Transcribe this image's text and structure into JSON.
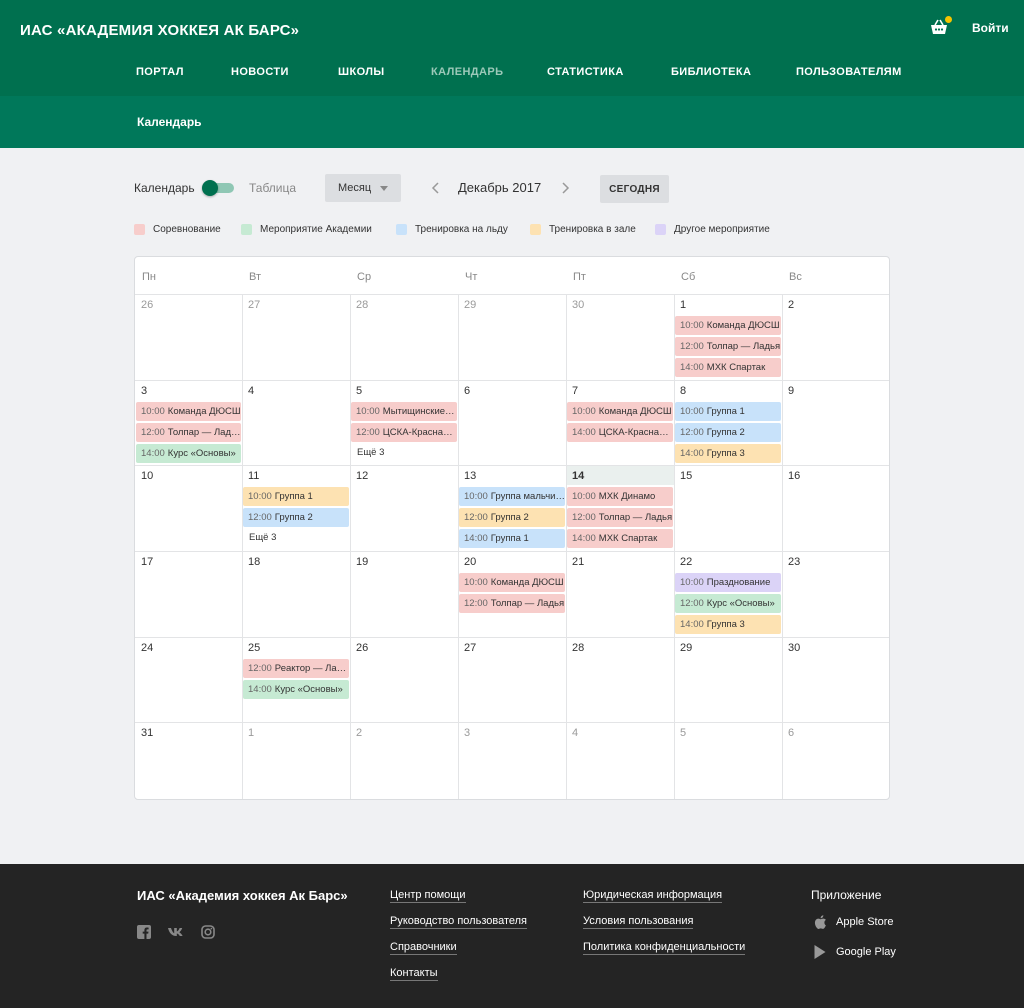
{
  "header": {
    "brand": "ИАС «АКАДЕМИЯ ХОККЕЯ АК БАРС»",
    "login": "Войти",
    "nav": [
      "ПОРТАЛ",
      "НОВОСТИ",
      "ШКОЛЫ",
      "КАЛЕНДАРЬ",
      "СТАТИСТИКА",
      "БИБЛИОТЕКА",
      "ПОЛЬЗОВАТЕЛЯМ"
    ],
    "active_nav": "КАЛЕНДАРЬ",
    "sub_title": "Календарь"
  },
  "toolbar": {
    "view_calendar": "Календарь",
    "view_table": "Таблица",
    "toggle_on": true,
    "period_select": "Месяц",
    "month_title": "Декабрь 2017",
    "today_button": "СЕГОДНЯ"
  },
  "legend": [
    {
      "label": "Соревнование",
      "color": "#f7cdcb",
      "key": "comp"
    },
    {
      "label": "Мероприятие Академии",
      "color": "#c6ead3",
      "key": "acad"
    },
    {
      "label": "Тренировка на льду",
      "color": "#c8e2fa",
      "key": "ice"
    },
    {
      "label": "Тренировка в зале",
      "color": "#fde2b2",
      "key": "gym"
    },
    {
      "label": "Другое мероприятие",
      "color": "#dbd3f7",
      "key": "other"
    }
  ],
  "calendar": {
    "weekdays": [
      "Пн",
      "Вт",
      "Ср",
      "Чт",
      "Пт",
      "Сб",
      "Вс"
    ],
    "today_day": "14",
    "weeks": [
      [
        {
          "day": "26",
          "other": true,
          "events": []
        },
        {
          "day": "27",
          "other": true,
          "events": []
        },
        {
          "day": "28",
          "other": true,
          "events": []
        },
        {
          "day": "29",
          "other": true,
          "events": []
        },
        {
          "day": "30",
          "other": true,
          "events": []
        },
        {
          "day": "1",
          "events": [
            {
              "time": "10:00",
              "title": "Команда ДЮСШ",
              "type": "comp"
            },
            {
              "time": "12:00",
              "title": "Толпар — Ладья",
              "type": "comp"
            },
            {
              "time": "14:00",
              "title": "МХК Спартак",
              "type": "comp"
            }
          ]
        },
        {
          "day": "2",
          "events": []
        }
      ],
      [
        {
          "day": "3",
          "events": [
            {
              "time": "10:00",
              "title": "Команда ДЮСШ",
              "type": "comp"
            },
            {
              "time": "12:00",
              "title": "Толпар — Ладья",
              "type": "comp"
            },
            {
              "time": "14:00",
              "title": "Курс «Основы»",
              "type": "acad"
            }
          ]
        },
        {
          "day": "4",
          "events": []
        },
        {
          "day": "5",
          "events": [
            {
              "time": "10:00",
              "title": "Мытищинские Атланты",
              "type": "comp"
            },
            {
              "time": "12:00",
              "title": "ЦСКА-Красная Армия",
              "type": "comp"
            }
          ],
          "more": "Ещё 3"
        },
        {
          "day": "6",
          "events": []
        },
        {
          "day": "7",
          "events": [
            {
              "time": "10:00",
              "title": "Команда ДЮСШ",
              "type": "comp"
            },
            {
              "time": "14:00",
              "title": "ЦСКА-Красная Армия",
              "type": "comp"
            }
          ]
        },
        {
          "day": "8",
          "events": [
            {
              "time": "10:00",
              "title": "Группа 1",
              "type": "ice"
            },
            {
              "time": "12:00",
              "title": "Группа 2",
              "type": "ice"
            },
            {
              "time": "14:00",
              "title": "Группа 3",
              "type": "gym"
            }
          ]
        },
        {
          "day": "9",
          "events": []
        }
      ],
      [
        {
          "day": "10",
          "events": []
        },
        {
          "day": "11",
          "events": [
            {
              "time": "10:00",
              "title": "Группа 1",
              "type": "gym"
            },
            {
              "time": "12:00",
              "title": "Группа 2",
              "type": "ice"
            }
          ],
          "more": "Ещё 3"
        },
        {
          "day": "12",
          "events": []
        },
        {
          "day": "13",
          "events": [
            {
              "time": "10:00",
              "title": "Группа мальчиков",
              "type": "ice"
            },
            {
              "time": "12:00",
              "title": "Группа 2",
              "type": "gym"
            },
            {
              "time": "14:00",
              "title": "Группа 1",
              "type": "ice"
            }
          ]
        },
        {
          "day": "14",
          "today": true,
          "events": [
            {
              "time": "10:00",
              "title": "МХК Динамо",
              "type": "comp"
            },
            {
              "time": "12:00",
              "title": "Толпар — Ладья",
              "type": "comp"
            },
            {
              "time": "14:00",
              "title": "МХК Спартак",
              "type": "comp"
            }
          ]
        },
        {
          "day": "15",
          "events": []
        },
        {
          "day": "16",
          "events": []
        }
      ],
      [
        {
          "day": "17",
          "events": []
        },
        {
          "day": "18",
          "events": []
        },
        {
          "day": "19",
          "events": []
        },
        {
          "day": "20",
          "events": [
            {
              "time": "10:00",
              "title": "Команда ДЮСШ",
              "type": "comp"
            },
            {
              "time": "12:00",
              "title": "Толпар — Ладья",
              "type": "comp"
            }
          ]
        },
        {
          "day": "21",
          "events": []
        },
        {
          "day": "22",
          "events": [
            {
              "time": "10:00",
              "title": "Празднование",
              "type": "other"
            },
            {
              "time": "12:00",
              "title": "Курс «Основы»",
              "type": "acad"
            },
            {
              "time": "14:00",
              "title": "Группа 3",
              "type": "gym"
            }
          ]
        },
        {
          "day": "23",
          "events": []
        }
      ],
      [
        {
          "day": "24",
          "events": []
        },
        {
          "day": "25",
          "events": [
            {
              "time": "12:00",
              "title": "Реактор — Ладья",
              "type": "comp"
            },
            {
              "time": "14:00",
              "title": "Курс «Основы»",
              "type": "acad"
            }
          ]
        },
        {
          "day": "26",
          "events": []
        },
        {
          "day": "27",
          "events": []
        },
        {
          "day": "28",
          "events": []
        },
        {
          "day": "29",
          "events": []
        },
        {
          "day": "30",
          "events": []
        }
      ],
      [
        {
          "day": "31",
          "events": []
        },
        {
          "day": "1",
          "other": true,
          "events": []
        },
        {
          "day": "2",
          "other": true,
          "events": []
        },
        {
          "day": "3",
          "other": true,
          "events": []
        },
        {
          "day": "4",
          "other": true,
          "events": []
        },
        {
          "day": "5",
          "other": true,
          "events": []
        },
        {
          "day": "6",
          "other": true,
          "events": []
        }
      ]
    ]
  },
  "footer": {
    "brand": "ИАС «Академия хоккея Ак Барс»",
    "social_icons": [
      "facebook-icon",
      "vk-icon",
      "instagram-icon"
    ],
    "col1": [
      "Центр помощи",
      "Руководство пользователя",
      "Справочники",
      "Контакты"
    ],
    "col2": [
      "Юридическая информация",
      "Условия пользования",
      "Политика конфиденциальности"
    ],
    "app_title": "Приложение",
    "stores": [
      {
        "label": "Apple Store",
        "icon": "apple-icon"
      },
      {
        "label": "Google Play",
        "icon": "google-play-icon"
      }
    ]
  }
}
